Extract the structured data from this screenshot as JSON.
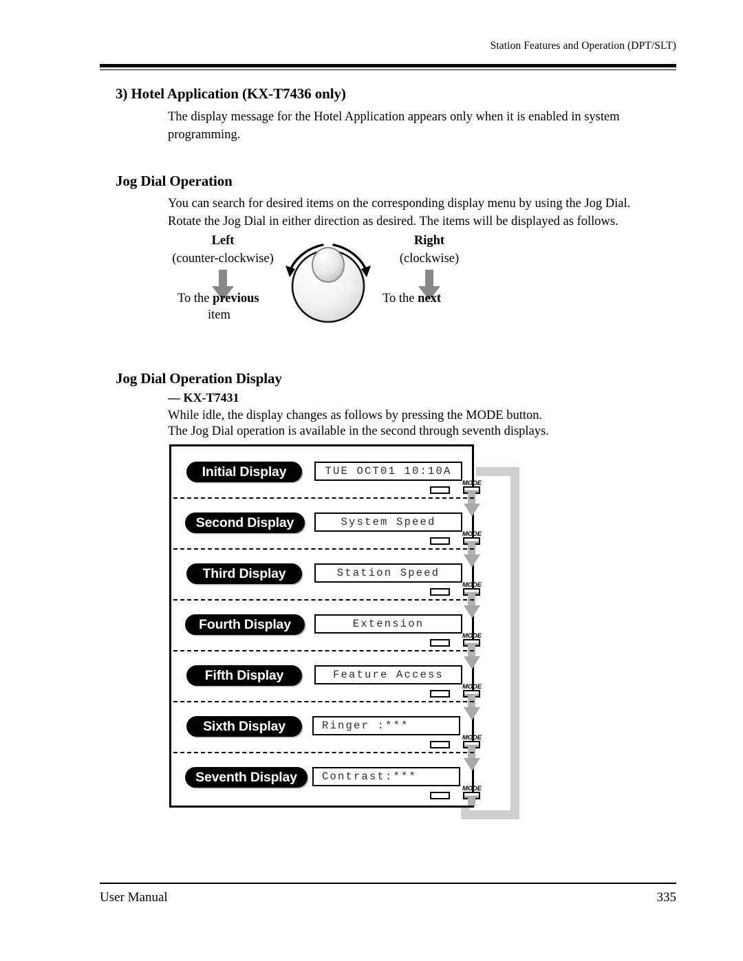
{
  "header": {
    "running_head": "Station Features and Operation (DPT/SLT)"
  },
  "sections": {
    "hotel": {
      "heading": "3) Hotel Application (KX-T7436 only)",
      "paragraph": "The display message for the Hotel Application appears only when it is enabled in system programming."
    },
    "jog_dial_operation": {
      "heading": "Jog Dial Operation",
      "paragraph": "You can search for desired items on the corresponding display menu by using the Jog Dial. Rotate the Jog Dial in either direction as desired. The items will be displayed as follows.",
      "figure": {
        "left_label": "Left",
        "left_sub": "(counter-clockwise)",
        "left_dest_prefix": "To the ",
        "left_dest_strong": "previous",
        "left_dest_line2": "item",
        "right_label": "Right",
        "right_sub": "(clockwise)",
        "right_dest_prefix": "To the ",
        "right_dest_strong": "next",
        "dial_icon": "jog-dial-icon",
        "ccw_arrow_icon": "counter-clockwise-arrow-icon",
        "cw_arrow_icon": "clockwise-arrow-icon",
        "left_down_arrow_icon": "down-arrow-icon",
        "right_down_arrow_icon": "down-arrow-icon"
      }
    },
    "jog_dial_operation_display": {
      "heading": "Jog Dial Operation Display",
      "model": "— KX-T7431",
      "paragraph_line1": "While idle, the display changes as follows by pressing the MODE button.",
      "paragraph_line2": "The Jog Dial operation is available in the second through seventh displays."
    }
  },
  "flow": {
    "mode_button_label": "MODE",
    "loop_arrow_icon": "loop-back-arrow-icon",
    "rows": [
      {
        "pill": "Initial Display",
        "lcd": "TUE OCT01 10:10A",
        "align": "center"
      },
      {
        "pill": "Second Display",
        "lcd": "System Speed",
        "align": "center"
      },
      {
        "pill": "Third Display",
        "lcd": "Station Speed",
        "align": "center"
      },
      {
        "pill": "Fourth Display",
        "lcd": "Extension",
        "align": "center"
      },
      {
        "pill": "Fifth Display",
        "lcd": "Feature Access",
        "align": "center"
      },
      {
        "pill": "Sixth Display",
        "lcd": "Ringer :***",
        "align": "left"
      },
      {
        "pill": "Seventh Display",
        "lcd": "Contrast:***",
        "align": "left"
      }
    ]
  },
  "footer": {
    "left": "User Manual",
    "page_number": "335"
  },
  "colors": {
    "ink": "#000000",
    "arrow_grey": "#a8a8a8",
    "loop_grey": "#cfcfcf"
  }
}
